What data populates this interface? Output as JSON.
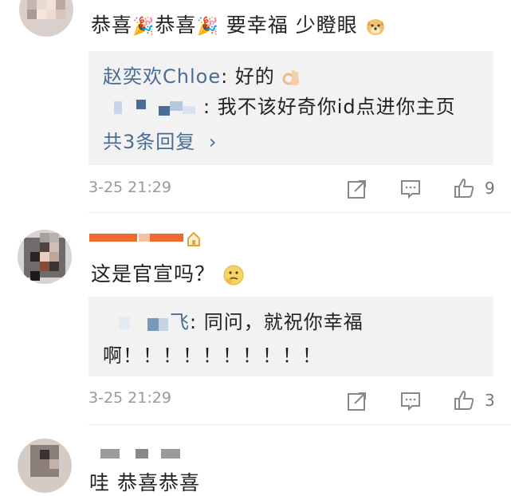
{
  "comments": [
    {
      "text": "恭喜🎉恭喜🎉 要幸福 少瞪眼",
      "text_parts": [
        "恭喜",
        "恭喜",
        " 要幸福 少瞪眼"
      ],
      "party_icon": "🎉",
      "doge_icon": "doge-emoji",
      "replies": [
        {
          "author": "赵奕欢Chloe",
          "sep": ": ",
          "text": "好的",
          "emoji": "ok-hand-emoji"
        },
        {
          "author": "",
          "sep": ": ",
          "text": "我不该好奇你id点进你主页"
        }
      ],
      "more_replies": "共3条回复",
      "more_arrow": "›",
      "time": "3-25 21:29",
      "likes": "9"
    },
    {
      "text": "这是官宣吗？",
      "emoji": "thinking-emoji",
      "replies": [
        {
          "author": "飞",
          "sep": ": ",
          "text": "同问，就祝你幸福"
        },
        {
          "text": "啊！！！！！！！！！！"
        }
      ],
      "time": "3-25 21:29",
      "likes": "3"
    },
    {
      "text": "哇 恭喜恭喜"
    }
  ],
  "colors": {
    "link": "#4a6d96",
    "reply_bg": "#f2f2f2",
    "meta": "#999999",
    "username_bar": "#f06a2e"
  }
}
